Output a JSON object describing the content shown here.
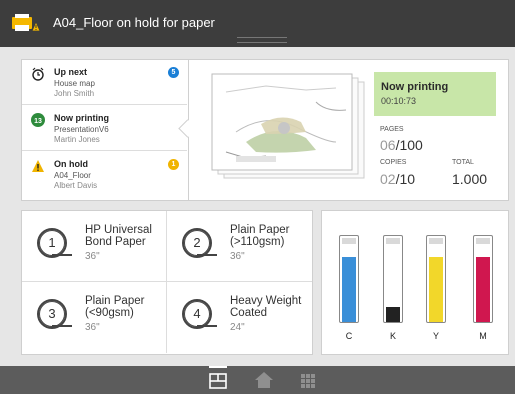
{
  "header": {
    "title": "A04_Floor on hold for paper",
    "icon": "printer-warning-icon"
  },
  "queue": {
    "items": [
      {
        "title": "Up next",
        "line1": "House map",
        "line2": "John Smith",
        "icon": "clock-icon",
        "badge": "5",
        "badge_color": "#1a7fd6"
      },
      {
        "title": "Now printing",
        "line1": "PresentationV6",
        "line2": "Martin Jones",
        "icon": "print-count-icon",
        "icon_text": "13",
        "icon_color": "#2e8b3c"
      },
      {
        "title": "On hold",
        "line1": "A04_Floor",
        "line2": "Albert Davis",
        "icon": "warning-icon",
        "badge": "1",
        "badge_color": "#f0b400"
      }
    ]
  },
  "status": {
    "title": "Now printing",
    "time": "00:10:73",
    "pages_label": "PAGES",
    "pages_current": "06",
    "pages_total": "/100",
    "copies_label": "COPIES",
    "copies_current": "02",
    "copies_total": "/10",
    "total_label": "TOTAL",
    "total_value": "1.000"
  },
  "rolls": [
    {
      "num": "1",
      "name_l1": "HP Universal",
      "name_l2": "Bond Paper",
      "size": "36\""
    },
    {
      "num": "2",
      "name_l1": "Plain Paper",
      "name_l2": "(>110gsm)",
      "size": "36\""
    },
    {
      "num": "3",
      "name_l1": "Plain Paper",
      "name_l2": "(<90gsm)",
      "size": "36\""
    },
    {
      "num": "4",
      "name_l1": "Heavy Weight",
      "name_l2": "Coated",
      "size": "24\""
    }
  ],
  "inks": [
    {
      "letter": "C",
      "color": "#3a8fd8",
      "level": 0.93
    },
    {
      "letter": "K",
      "color": "#222222",
      "level": 0.22
    },
    {
      "letter": "Y",
      "color": "#f2d72a",
      "level": 0.93
    },
    {
      "letter": "M",
      "color": "#d0174f",
      "level": 0.93
    }
  ],
  "nav": {
    "tabs": [
      {
        "icon": "jobs-view-icon",
        "active": true
      },
      {
        "icon": "home-icon",
        "active": false
      },
      {
        "icon": "apps-grid-icon",
        "active": false
      }
    ]
  }
}
